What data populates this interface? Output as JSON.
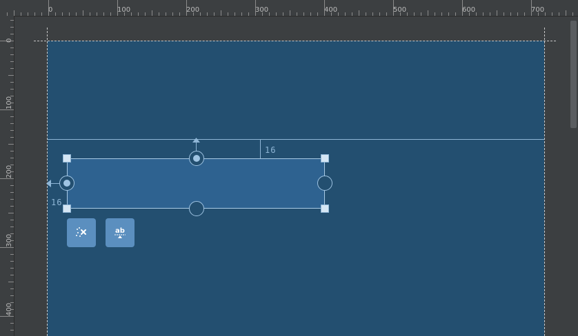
{
  "ruler": {
    "top_labels": [
      "0",
      "100",
      "200",
      "300",
      "400",
      "500",
      "600",
      "700"
    ],
    "left_labels": [
      "0",
      "100",
      "200",
      "300",
      "400"
    ]
  },
  "constraints": {
    "top_margin": "16",
    "left_margin": "16"
  },
  "actions": {
    "clear_constraints_icon": "clear-constraints-icon",
    "baseline_icon": "text-baseline-icon",
    "baseline_text": "ab"
  },
  "colors": {
    "canvas": "#3c3f41",
    "device_background": "#234f70",
    "widget_fill": "#2e6290",
    "accent": "#8fb6d6"
  }
}
